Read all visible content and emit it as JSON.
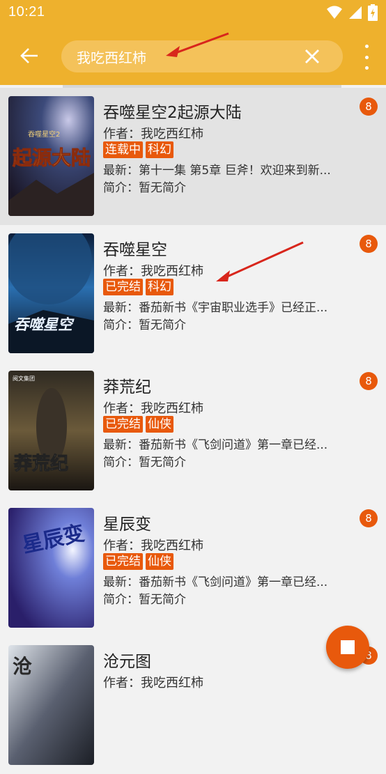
{
  "status_bar": {
    "time": "10:21"
  },
  "search": {
    "query": "我吃西红柿"
  },
  "books": [
    {
      "title": "吞噬星空2起源大陆",
      "author": "作者：我吃西红柿",
      "tags": [
        "连载中",
        "科幻"
      ],
      "latest": "最新：第十一集 第5章 巨斧！欢迎来到新...",
      "intro": "简介：暂无简介",
      "badge": "8",
      "cover_text": "起源大陆",
      "cover_top": "吞噬星空2"
    },
    {
      "title": "吞噬星空",
      "author": "作者：我吃西红柿",
      "tags": [
        "已完结",
        "科幻"
      ],
      "latest": "最新：番茄新书《宇宙职业选手》已经正...",
      "intro": "简介：暂无简介",
      "badge": "8",
      "cover_text": "吞噬星空"
    },
    {
      "title": "莽荒纪",
      "author": "作者：我吃西红柿",
      "tags": [
        "已完结",
        "仙侠"
      ],
      "latest": "最新：番茄新书《飞剑问道》第一章已经...",
      "intro": "简介：暂无简介",
      "badge": "8",
      "cover_text": "莽荒纪",
      "cover_top": "阅文集团"
    },
    {
      "title": "星辰变",
      "author": "作者：我吃西红柿",
      "tags": [
        "已完结",
        "仙侠"
      ],
      "latest": "最新：番茄新书《飞剑问道》第一章已经...",
      "intro": "简介：暂无简介",
      "badge": "8",
      "cover_text": "星辰变"
    },
    {
      "title": "沧元图",
      "author": "作者：我吃西红柿",
      "badge": "8",
      "cover_text": "沧"
    }
  ]
}
